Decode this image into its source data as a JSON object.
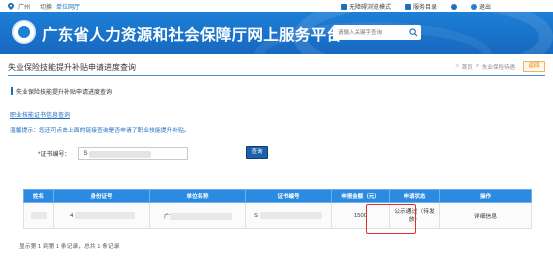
{
  "topbar": {
    "city": "广州",
    "switch_label": "切换",
    "unit_label": "单位网厅",
    "accessible_label": "无障碍浏览模式",
    "service_directory_label": "服务目录",
    "user_icon": "user-icon",
    "logout_label": "退出"
  },
  "banner": {
    "title": "广东省人力资源和社会保障厅网上服务平台",
    "search_placeholder": "请输入关键字查询"
  },
  "page": {
    "title": "失业保险技能提升补贴申请进度查询",
    "breadcrumb_home": "首页",
    "breadcrumb_sep": ">",
    "breadcrumb_current": "失业保险待遇",
    "back_label": "返回"
  },
  "section": {
    "title": "失业保险技能提升补贴申请进度查询"
  },
  "link_text": "职业技能证书信息查询",
  "tip_text": "温馨提示：您还可点击上面的链接查询是否申请了职业技能提升补贴。",
  "form": {
    "cert_label": "*证书编号：",
    "cert_value_prefix": "S",
    "query_label": "查询"
  },
  "table": {
    "headers": [
      "姓名",
      "身份证号",
      "单位名称",
      "证书编号",
      "申报金额（元）",
      "申请状态",
      "操作"
    ],
    "rows": [
      {
        "id_prefix": "4",
        "unit_prefix": "广",
        "cert_prefix": "S",
        "amount": "1500",
        "status": "公示通过（待发放）",
        "action": "详细信息"
      }
    ]
  },
  "footer": "显示第 1 到第 1 条记录，总共 1 条记录",
  "colors": {
    "banner": "#1d7fd6",
    "table_header": "#2b8be0",
    "highlight": "#e1302b",
    "link": "#1f6fbf"
  }
}
